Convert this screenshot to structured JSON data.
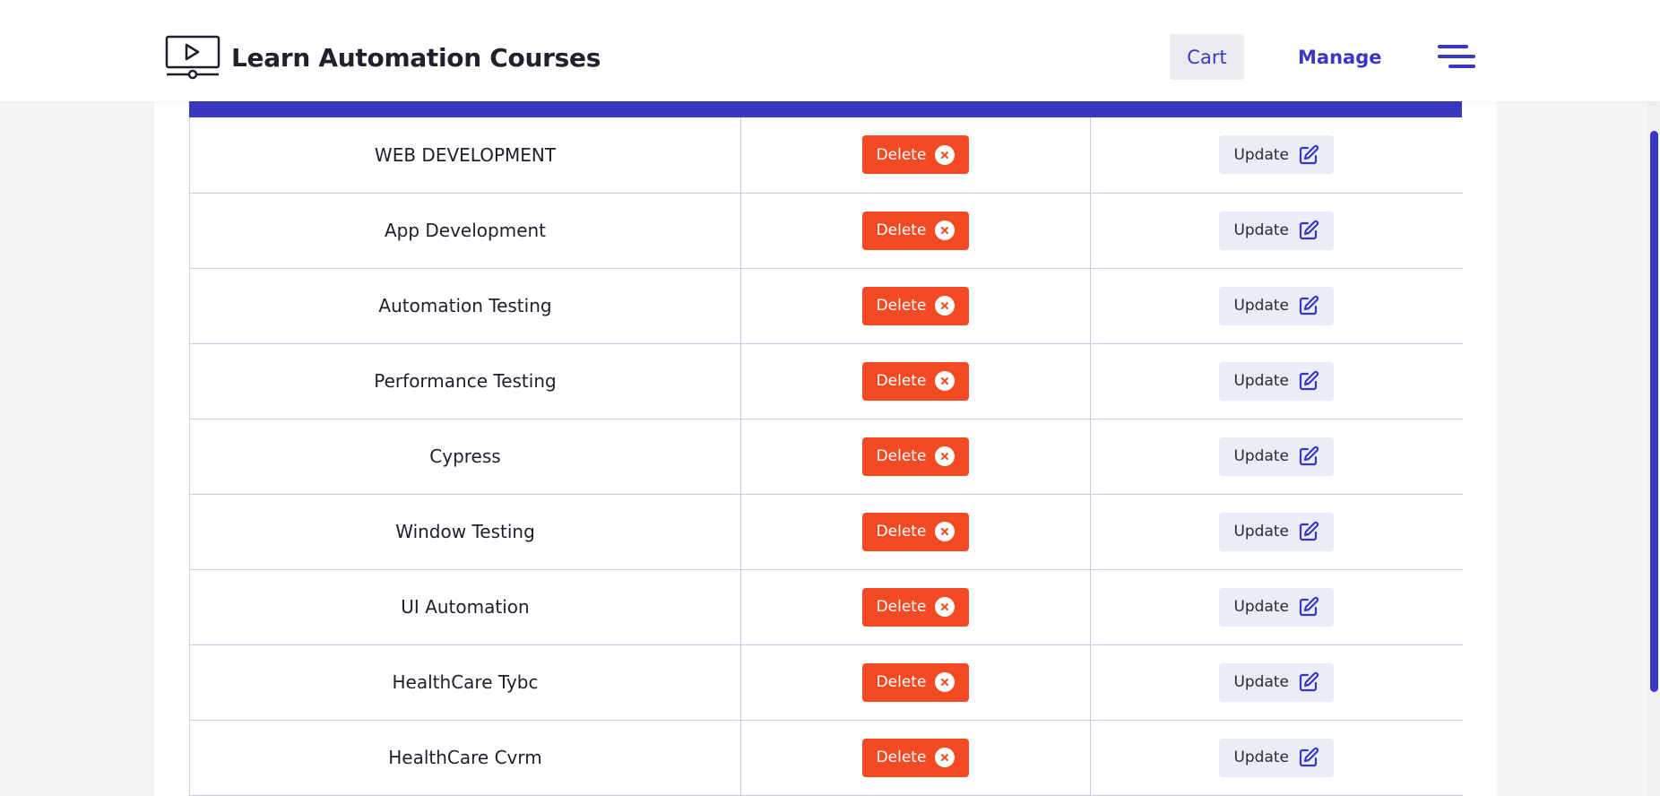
{
  "header": {
    "title": "Learn Automation Courses",
    "logo_icon": "video-player-icon",
    "cart_label": "Cart",
    "manage_label": "Manage",
    "menu_icon": "hamburger-menu-icon"
  },
  "colors": {
    "accent": "#3a38c2",
    "delete": "#f24a22",
    "update_bg": "#eaedf6",
    "table_border": "#c9c9ee"
  },
  "table": {
    "delete_label": "Delete",
    "update_label": "Update",
    "delete_icon": "x-circle-icon",
    "update_icon": "edit-icon",
    "rows": [
      {
        "name": "WEB DEVELOPMENT"
      },
      {
        "name": "App Development"
      },
      {
        "name": "Automation Testing"
      },
      {
        "name": "Performance Testing"
      },
      {
        "name": "Cypress"
      },
      {
        "name": "Window Testing"
      },
      {
        "name": "UI Automation"
      },
      {
        "name": "HealthCare Tybc"
      },
      {
        "name": "HealthCare Cvrm"
      }
    ]
  }
}
